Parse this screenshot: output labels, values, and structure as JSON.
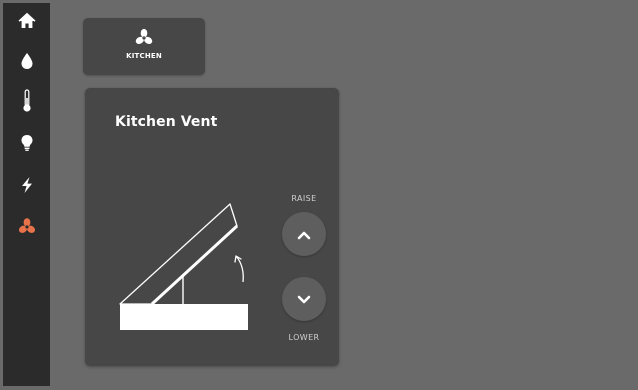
{
  "colors": {
    "background": "#6a6a6a",
    "sidebar": "#2b2b2b",
    "card": "#474747",
    "accent": "#e8734a",
    "icon": "#ffffff"
  },
  "sidebar": {
    "items": [
      {
        "icon": "home-icon",
        "active": false
      },
      {
        "icon": "water-drop-icon",
        "active": false
      },
      {
        "icon": "thermometer-icon",
        "active": false
      },
      {
        "icon": "lightbulb-icon",
        "active": false
      },
      {
        "icon": "lightning-bolt-icon",
        "active": false
      },
      {
        "icon": "fan-icon",
        "active": true
      }
    ]
  },
  "tab": {
    "icon": "fan-icon",
    "label": "KITCHEN"
  },
  "vent": {
    "title": "Kitchen Vent",
    "raise_label": "RAISE",
    "lower_label": "LOWER"
  }
}
